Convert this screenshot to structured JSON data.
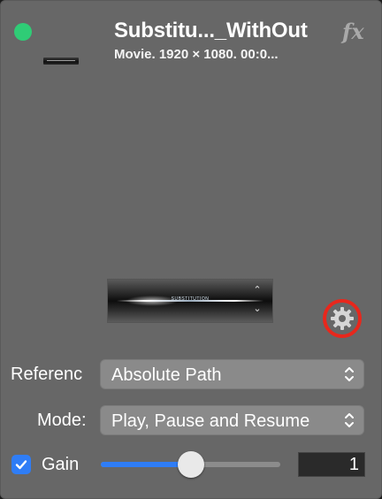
{
  "header": {
    "title": "Substitu..._WithOut",
    "subtitle": "Movie. 1920 × 1080. 00:0...",
    "fx_icon": "fx-icon",
    "status_color": "#2fcc76"
  },
  "preview": {
    "label": "SUBSTITUTION"
  },
  "reference": {
    "label": "Referenc",
    "value": "Absolute Path"
  },
  "mode": {
    "label": "Mode:",
    "value": "Play, Pause and Resume"
  },
  "gain": {
    "label": "Gain",
    "checked": true,
    "slider_level": 0.5,
    "value": "1"
  },
  "colors": {
    "panel": "#676767",
    "accent": "#2f7df6",
    "highlight_ring": "#e8271c"
  }
}
